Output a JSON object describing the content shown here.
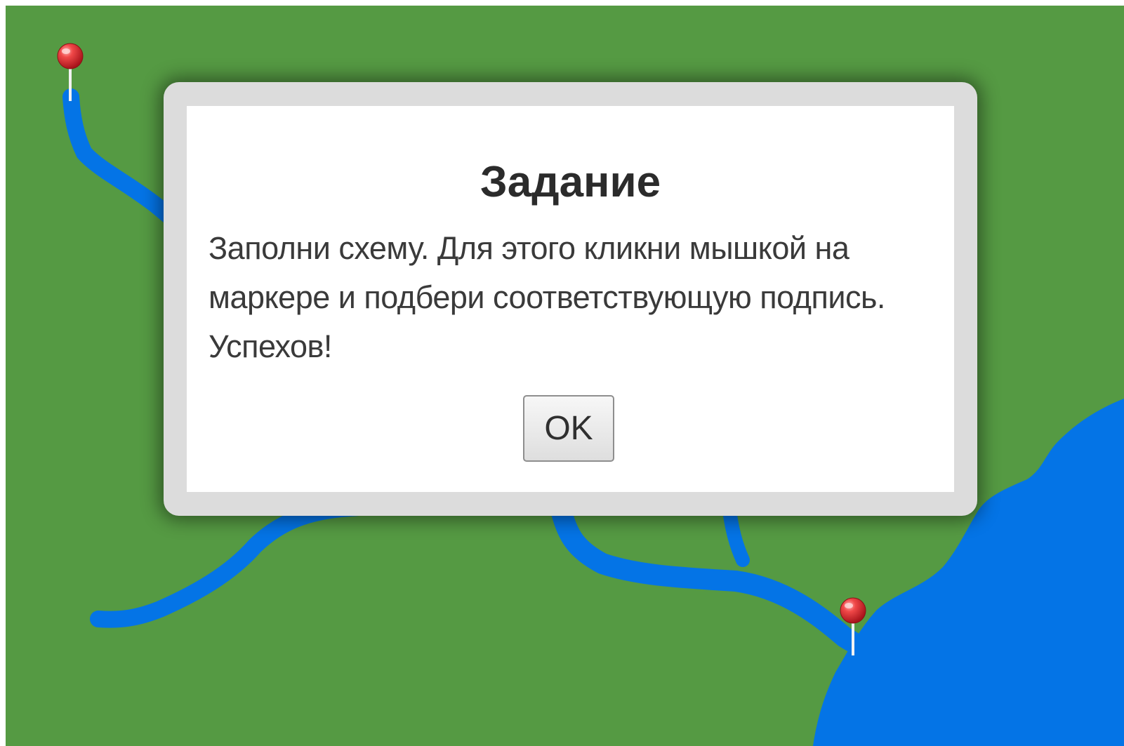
{
  "dialog": {
    "title": "Задание",
    "message": "Заполни схему. Для этого кликни мышкой на маркере и подбери соответствующую подпись. Успехов!",
    "ok_label": "OK"
  },
  "colors": {
    "land": "#559a43",
    "water": "#0474e6",
    "pin": "#e0333a",
    "dialog_frame": "#dcdcdc"
  },
  "map": {
    "markers": [
      {
        "icon": "map-pin-icon"
      },
      {
        "icon": "map-pin-icon"
      }
    ]
  }
}
